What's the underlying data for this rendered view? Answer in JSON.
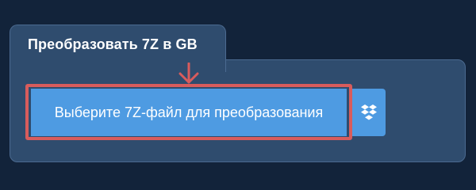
{
  "converter": {
    "title": "Преобразовать 7Z в GB",
    "choose_file_label": "Выберите 7Z-файл для преобразования",
    "dropbox_icon": "dropbox-icon",
    "arrow_icon": "arrow-down-icon"
  },
  "colors": {
    "background": "#12233a",
    "panel": "#2f4c6e",
    "button": "#4e9be2",
    "highlight": "#d85c5c"
  }
}
